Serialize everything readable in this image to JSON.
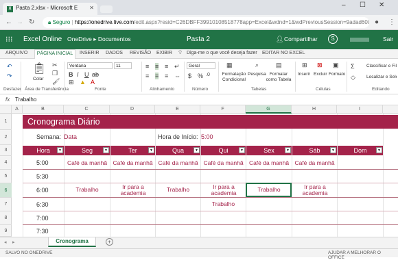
{
  "browser": {
    "tab_title": "Pasta 2.xlsx - Microsoft E",
    "secure_label": "Seguro",
    "url_domain": "https://onedrive.live.com",
    "url_rest": "/edit.aspx?resid=C26DBFF39910108518778app=Excel&wdnd=1&wdPreviousSession=9adad600-b8dd-49c..."
  },
  "app": {
    "name": "Excel Online",
    "breadcrumb": "OneDrive ▸ Documentos",
    "doc_title": "Pasta 2",
    "share_label": "Compartilhar",
    "signout_label": "Sair"
  },
  "ribbon_tabs": [
    "ARQUIVO",
    "PÁGINA INICIAL",
    "INSERIR",
    "DADOS",
    "REVISÃO",
    "EXIBIR",
    "Diga-me o que você deseja fazer",
    "EDITAR NO EXCEL"
  ],
  "ribbon": {
    "paste": "Colar",
    "undo_group": "Desfazer",
    "clipboard_group": "Área de Transferência",
    "font_name": "Verdana",
    "font_size": "11",
    "font_group": "Fonte",
    "align_group": "Alinhamento",
    "number_format": "Geral",
    "number_group": "Número",
    "cond_format": "Formatação Condicional",
    "search": "Pesquisa",
    "format_table": "Formatar como Tabela",
    "tables_group": "Tabelas",
    "insert": "Inserir",
    "delete": "Excluir",
    "format": "Formato",
    "cells_group": "Células",
    "sort_filter": "Classificar e Filtrar",
    "find_select": "Localizar e Selecionar",
    "editing_group": "Editando"
  },
  "formula_bar": {
    "fx": "fx",
    "value": "Trabalho"
  },
  "columns": [
    "A",
    "B",
    "C",
    "D",
    "E",
    "F",
    "G",
    "H",
    "I"
  ],
  "rows": [
    "1",
    "2",
    "3",
    "4",
    "5",
    "6",
    "7",
    "8",
    "9"
  ],
  "sheet": {
    "title": "Cronograma Diário",
    "week_label": "Semana:",
    "week_value": "Data",
    "start_label": "Hora de Início:",
    "start_value": "5:00",
    "hour_header": "Hora",
    "days": [
      "Seg",
      "Ter",
      "Qua",
      "Qui",
      "Sex",
      "Sáb",
      "Dom"
    ],
    "times": [
      "5:00",
      "5:30",
      "6:00",
      "6:30",
      "7:00",
      "7:30"
    ],
    "row_500": [
      "Café da manhã",
      "Café da manhã",
      "Café da manhã",
      "Café da manhã",
      "Café da manhã",
      "Café da manhã"
    ],
    "row_600": [
      "Trabalho",
      "Ir para a academia",
      "Trabalho",
      "Ir para a academia",
      "Trabalho",
      "Ir para a academia"
    ],
    "row_630": [
      "",
      "",
      "",
      "Trabalho",
      "",
      ""
    ]
  },
  "sheet_tab": "Cronograma",
  "status": {
    "left": "SALVO NO ONEDRIVE",
    "right": "AJUDAR A MELHORAR O OFFICE"
  },
  "colors": {
    "accent": "#217346",
    "banner": "#a4234a"
  }
}
